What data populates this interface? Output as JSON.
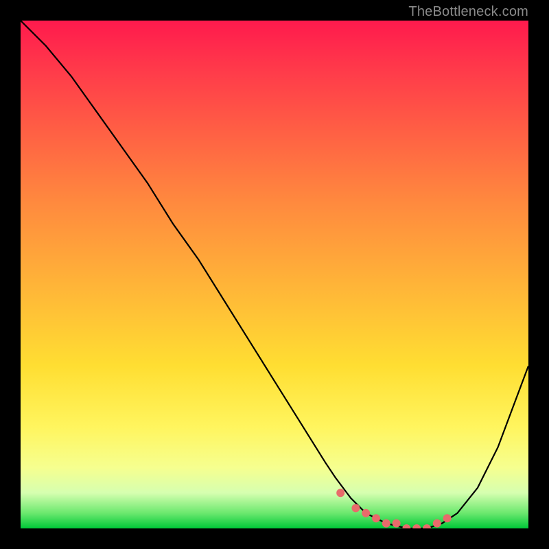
{
  "watermark": "TheBottleneck.com",
  "chart_data": {
    "type": "line",
    "title": "",
    "xlabel": "",
    "ylabel": "",
    "xlim": [
      0,
      100
    ],
    "ylim": [
      0,
      100
    ],
    "grid": false,
    "legend": false,
    "series": [
      {
        "name": "curve",
        "x": [
          0,
          5,
          10,
          15,
          20,
          25,
          30,
          35,
          40,
          45,
          50,
          55,
          60,
          62,
          65,
          68,
          72,
          76,
          80,
          83,
          86,
          90,
          94,
          97,
          100
        ],
        "y": [
          100,
          95,
          89,
          82,
          75,
          68,
          60,
          53,
          45,
          37,
          29,
          21,
          13,
          10,
          6,
          3,
          1,
          0,
          0,
          1,
          3,
          8,
          16,
          24,
          32
        ]
      },
      {
        "name": "sweet-spot-markers",
        "x": [
          63,
          66,
          68,
          70,
          72,
          74,
          76,
          78,
          80,
          82,
          84
        ],
        "y": [
          7,
          4,
          3,
          2,
          1,
          1,
          0,
          0,
          0,
          1,
          2
        ]
      }
    ],
    "gradient_stops": [
      {
        "pos": 0,
        "color": "#ff1a4d"
      },
      {
        "pos": 10,
        "color": "#ff3b4a"
      },
      {
        "pos": 22,
        "color": "#ff6044"
      },
      {
        "pos": 36,
        "color": "#ff8a3e"
      },
      {
        "pos": 52,
        "color": "#ffb438"
      },
      {
        "pos": 68,
        "color": "#ffde32"
      },
      {
        "pos": 80,
        "color": "#fff55e"
      },
      {
        "pos": 88,
        "color": "#f6ff8f"
      },
      {
        "pos": 93,
        "color": "#d6ffb0"
      },
      {
        "pos": 97,
        "color": "#6be86e"
      },
      {
        "pos": 100,
        "color": "#00c838"
      }
    ],
    "colors": {
      "curve": "#000000",
      "markers": "#e86b6b",
      "frame": "#000000"
    }
  }
}
